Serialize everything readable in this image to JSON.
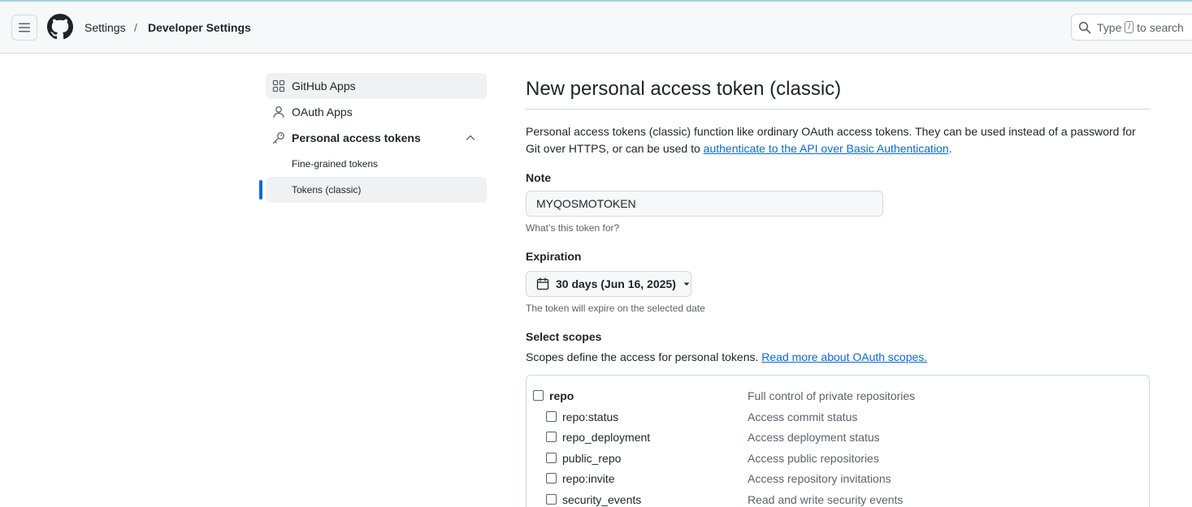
{
  "header": {
    "breadcrumb_settings": "Settings",
    "breadcrumb_separator": "/",
    "breadcrumb_current": "Developer Settings",
    "search_type": "Type",
    "search_key": "/",
    "search_suffix": "to search"
  },
  "sidebar": {
    "items": [
      {
        "label": "GitHub Apps",
        "icon": "apps-grid-icon"
      },
      {
        "label": "OAuth Apps",
        "icon": "person-icon"
      },
      {
        "label": "Personal access tokens",
        "icon": "key-icon"
      },
      {
        "label": "Fine-grained tokens"
      },
      {
        "label": "Tokens (classic)"
      }
    ]
  },
  "main": {
    "title": "New personal access token (classic)",
    "intro_text": "Personal access tokens (classic) function like ordinary OAuth access tokens. They can be used instead of a password for Git over HTTPS, or can be used to ",
    "intro_link": "authenticate to the API over Basic Authentication",
    "intro_end": ".",
    "note_label": "Note",
    "note_value": "MYQOSMOTOKEN",
    "note_hint": "What’s this token for?",
    "expiration_label": "Expiration",
    "expiration_value": "30 days (Jun 16, 2025)",
    "expiration_hint": "The token will expire on the selected date",
    "scopes_label": "Select scopes",
    "scopes_desc": "Scopes define the access for personal tokens. ",
    "scopes_link": "Read more about OAuth scopes.",
    "scopes": [
      {
        "name": "repo",
        "desc": "Full control of private repositories",
        "parent": true
      },
      {
        "name": "repo:status",
        "desc": "Access commit status",
        "parent": false
      },
      {
        "name": "repo_deployment",
        "desc": "Access deployment status",
        "parent": false
      },
      {
        "name": "public_repo",
        "desc": "Access public repositories",
        "parent": false
      },
      {
        "name": "repo:invite",
        "desc": "Access repository invitations",
        "parent": false
      },
      {
        "name": "security_events",
        "desc": "Read and write security events",
        "parent": false
      }
    ]
  },
  "colors": {
    "accent": "#0969da",
    "border": "#d1d9e0",
    "muted_text": "#59636e"
  }
}
